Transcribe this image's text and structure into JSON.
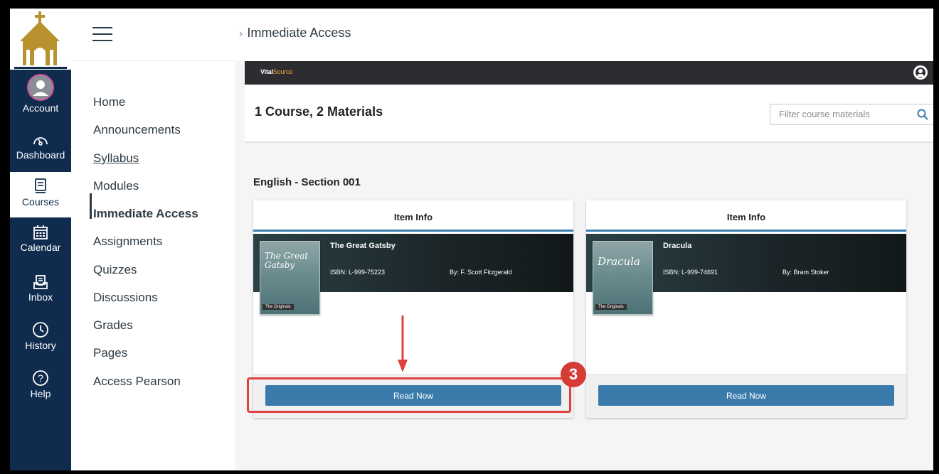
{
  "global_nav": {
    "items": [
      {
        "label": "Account",
        "icon": "account-avatar-icon"
      },
      {
        "label": "Dashboard",
        "icon": "dashboard-gauge-icon"
      },
      {
        "label": "Courses",
        "icon": "courses-book-icon"
      },
      {
        "label": "Calendar",
        "icon": "calendar-icon"
      },
      {
        "label": "Inbox",
        "icon": "inbox-icon"
      },
      {
        "label": "History",
        "icon": "clock-icon"
      },
      {
        "label": "Help",
        "icon": "help-circle-icon"
      }
    ],
    "active": "Courses",
    "bg_color": "#0f2b4e"
  },
  "breadcrumb": {
    "current": "Immediate Access"
  },
  "course_nav": {
    "items": [
      {
        "label": "Home"
      },
      {
        "label": "Announcements"
      },
      {
        "label": "Syllabus"
      },
      {
        "label": "Modules"
      },
      {
        "label": "Immediate Access"
      },
      {
        "label": "Assignments"
      },
      {
        "label": "Quizzes"
      },
      {
        "label": "Discussions"
      },
      {
        "label": "Grades"
      },
      {
        "label": "Pages"
      },
      {
        "label": "Access Pearson"
      }
    ],
    "active": "Immediate Access"
  },
  "vitalsource": {
    "logo_vital": "Vital",
    "logo_source": "Source"
  },
  "materials": {
    "title": "1 Course,  2 Materials",
    "filter_placeholder": "Filter course materials",
    "section_title": "English - Section 001"
  },
  "cards": [
    {
      "header": "Item Info",
      "title": "The Great Gatsby",
      "cover_title": "The Great Gatsby",
      "cover_tag": "The Originals",
      "isbn": "ISBN: L-999-75223",
      "author": "By: F. Scott Fitzgerald",
      "button": "Read Now"
    },
    {
      "header": "Item Info",
      "title": "Dracula",
      "cover_title": "Dracula",
      "cover_tag": "The Originals",
      "isbn": "ISBN: L-999-74691",
      "author": "By: Bram Stoker",
      "button": "Read Now"
    }
  ],
  "annotation": {
    "step_number": "3",
    "color": "#d63c36"
  },
  "colors": {
    "accent_blue": "#3b7bab",
    "vs_bar": "#2d2d31"
  }
}
